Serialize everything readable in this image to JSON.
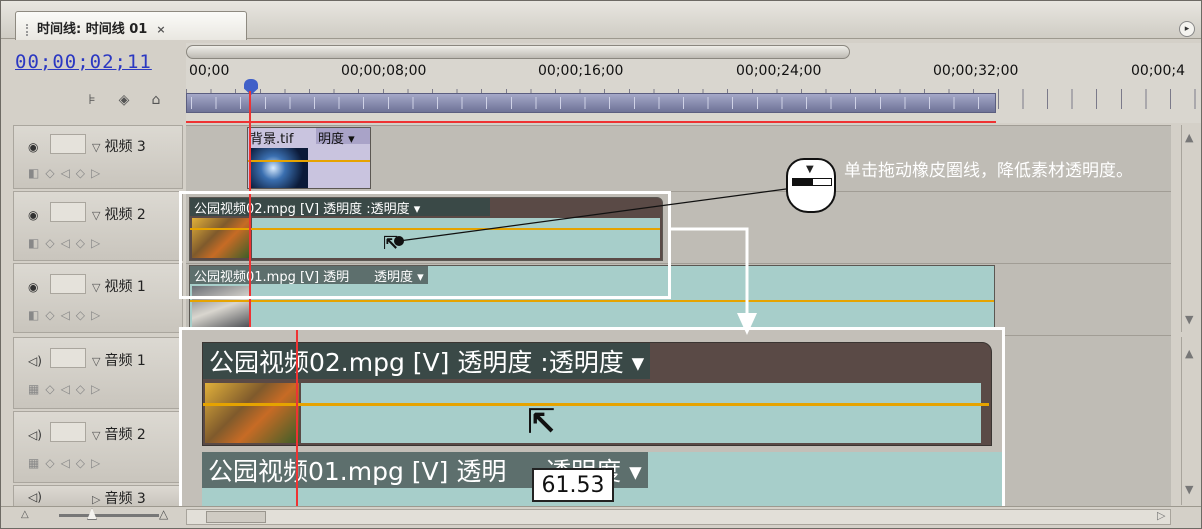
{
  "tab": {
    "title": "时间线: 时间线 01",
    "close": "×"
  },
  "panel_menu_icon": "panel-menu-icon",
  "timecode": "00;00;02;11",
  "ruler": {
    "labels": [
      "00;00",
      "00;00;08;00",
      "00;00;16;00",
      "00;00;24;00",
      "00;00;32;00",
      "00;00;4"
    ]
  },
  "tracks": {
    "video3": {
      "name": "视频 3"
    },
    "video2": {
      "name": "视频 2"
    },
    "video1": {
      "name": "视频 1"
    },
    "audio1": {
      "name": "音频 1"
    },
    "audio2": {
      "name": "音频 2"
    },
    "audio3": {
      "name": "音频 3"
    }
  },
  "clips": {
    "bg": {
      "name": "背景.tif",
      "fx": "明度"
    },
    "park02": {
      "name": "公园视频02.mpg [V]",
      "fx": "透明度 :透明度"
    },
    "park01": {
      "name": "公园视频01.mpg [V]",
      "fx_a": "透明",
      "fx_b": "透明度"
    }
  },
  "tooltip_value": "61.53",
  "zoom_clips": {
    "park02": {
      "name": "公园视频02.mpg [V]",
      "fx": "透明度 :透明度"
    },
    "park01": {
      "name": "公园视频01.mpg [V]",
      "fx_a": "透明",
      "fx_b": "透明度"
    }
  },
  "annotation": {
    "text": "单击拖动橡皮圈线，降低素材透明度。"
  },
  "icons": [
    "eye-icon",
    "filmstrip-icon",
    "keyframe-icon",
    "speaker-icon",
    "snap-icon",
    "marker-icon",
    "mouse-icon"
  ]
}
